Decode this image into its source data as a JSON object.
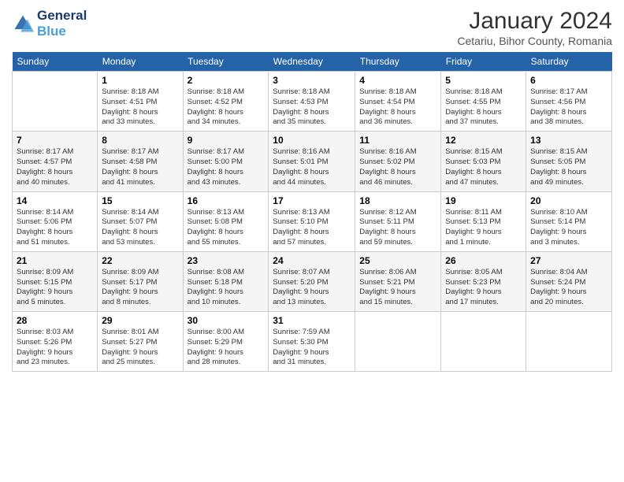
{
  "logo": {
    "line1": "General",
    "line2": "Blue"
  },
  "title": "January 2024",
  "subtitle": "Cetariu, Bihor County, Romania",
  "weekdays": [
    "Sunday",
    "Monday",
    "Tuesday",
    "Wednesday",
    "Thursday",
    "Friday",
    "Saturday"
  ],
  "weeks": [
    [
      {
        "day": "",
        "info": ""
      },
      {
        "day": "1",
        "info": "Sunrise: 8:18 AM\nSunset: 4:51 PM\nDaylight: 8 hours\nand 33 minutes."
      },
      {
        "day": "2",
        "info": "Sunrise: 8:18 AM\nSunset: 4:52 PM\nDaylight: 8 hours\nand 34 minutes."
      },
      {
        "day": "3",
        "info": "Sunrise: 8:18 AM\nSunset: 4:53 PM\nDaylight: 8 hours\nand 35 minutes."
      },
      {
        "day": "4",
        "info": "Sunrise: 8:18 AM\nSunset: 4:54 PM\nDaylight: 8 hours\nand 36 minutes."
      },
      {
        "day": "5",
        "info": "Sunrise: 8:18 AM\nSunset: 4:55 PM\nDaylight: 8 hours\nand 37 minutes."
      },
      {
        "day": "6",
        "info": "Sunrise: 8:17 AM\nSunset: 4:56 PM\nDaylight: 8 hours\nand 38 minutes."
      }
    ],
    [
      {
        "day": "7",
        "info": "Sunrise: 8:17 AM\nSunset: 4:57 PM\nDaylight: 8 hours\nand 40 minutes."
      },
      {
        "day": "8",
        "info": "Sunrise: 8:17 AM\nSunset: 4:58 PM\nDaylight: 8 hours\nand 41 minutes."
      },
      {
        "day": "9",
        "info": "Sunrise: 8:17 AM\nSunset: 5:00 PM\nDaylight: 8 hours\nand 43 minutes."
      },
      {
        "day": "10",
        "info": "Sunrise: 8:16 AM\nSunset: 5:01 PM\nDaylight: 8 hours\nand 44 minutes."
      },
      {
        "day": "11",
        "info": "Sunrise: 8:16 AM\nSunset: 5:02 PM\nDaylight: 8 hours\nand 46 minutes."
      },
      {
        "day": "12",
        "info": "Sunrise: 8:15 AM\nSunset: 5:03 PM\nDaylight: 8 hours\nand 47 minutes."
      },
      {
        "day": "13",
        "info": "Sunrise: 8:15 AM\nSunset: 5:05 PM\nDaylight: 8 hours\nand 49 minutes."
      }
    ],
    [
      {
        "day": "14",
        "info": "Sunrise: 8:14 AM\nSunset: 5:06 PM\nDaylight: 8 hours\nand 51 minutes."
      },
      {
        "day": "15",
        "info": "Sunrise: 8:14 AM\nSunset: 5:07 PM\nDaylight: 8 hours\nand 53 minutes."
      },
      {
        "day": "16",
        "info": "Sunrise: 8:13 AM\nSunset: 5:08 PM\nDaylight: 8 hours\nand 55 minutes."
      },
      {
        "day": "17",
        "info": "Sunrise: 8:13 AM\nSunset: 5:10 PM\nDaylight: 8 hours\nand 57 minutes."
      },
      {
        "day": "18",
        "info": "Sunrise: 8:12 AM\nSunset: 5:11 PM\nDaylight: 8 hours\nand 59 minutes."
      },
      {
        "day": "19",
        "info": "Sunrise: 8:11 AM\nSunset: 5:13 PM\nDaylight: 9 hours\nand 1 minute."
      },
      {
        "day": "20",
        "info": "Sunrise: 8:10 AM\nSunset: 5:14 PM\nDaylight: 9 hours\nand 3 minutes."
      }
    ],
    [
      {
        "day": "21",
        "info": "Sunrise: 8:09 AM\nSunset: 5:15 PM\nDaylight: 9 hours\nand 5 minutes."
      },
      {
        "day": "22",
        "info": "Sunrise: 8:09 AM\nSunset: 5:17 PM\nDaylight: 9 hours\nand 8 minutes."
      },
      {
        "day": "23",
        "info": "Sunrise: 8:08 AM\nSunset: 5:18 PM\nDaylight: 9 hours\nand 10 minutes."
      },
      {
        "day": "24",
        "info": "Sunrise: 8:07 AM\nSunset: 5:20 PM\nDaylight: 9 hours\nand 13 minutes."
      },
      {
        "day": "25",
        "info": "Sunrise: 8:06 AM\nSunset: 5:21 PM\nDaylight: 9 hours\nand 15 minutes."
      },
      {
        "day": "26",
        "info": "Sunrise: 8:05 AM\nSunset: 5:23 PM\nDaylight: 9 hours\nand 17 minutes."
      },
      {
        "day": "27",
        "info": "Sunrise: 8:04 AM\nSunset: 5:24 PM\nDaylight: 9 hours\nand 20 minutes."
      }
    ],
    [
      {
        "day": "28",
        "info": "Sunrise: 8:03 AM\nSunset: 5:26 PM\nDaylight: 9 hours\nand 23 minutes."
      },
      {
        "day": "29",
        "info": "Sunrise: 8:01 AM\nSunset: 5:27 PM\nDaylight: 9 hours\nand 25 minutes."
      },
      {
        "day": "30",
        "info": "Sunrise: 8:00 AM\nSunset: 5:29 PM\nDaylight: 9 hours\nand 28 minutes."
      },
      {
        "day": "31",
        "info": "Sunrise: 7:59 AM\nSunset: 5:30 PM\nDaylight: 9 hours\nand 31 minutes."
      },
      {
        "day": "",
        "info": ""
      },
      {
        "day": "",
        "info": ""
      },
      {
        "day": "",
        "info": ""
      }
    ]
  ]
}
